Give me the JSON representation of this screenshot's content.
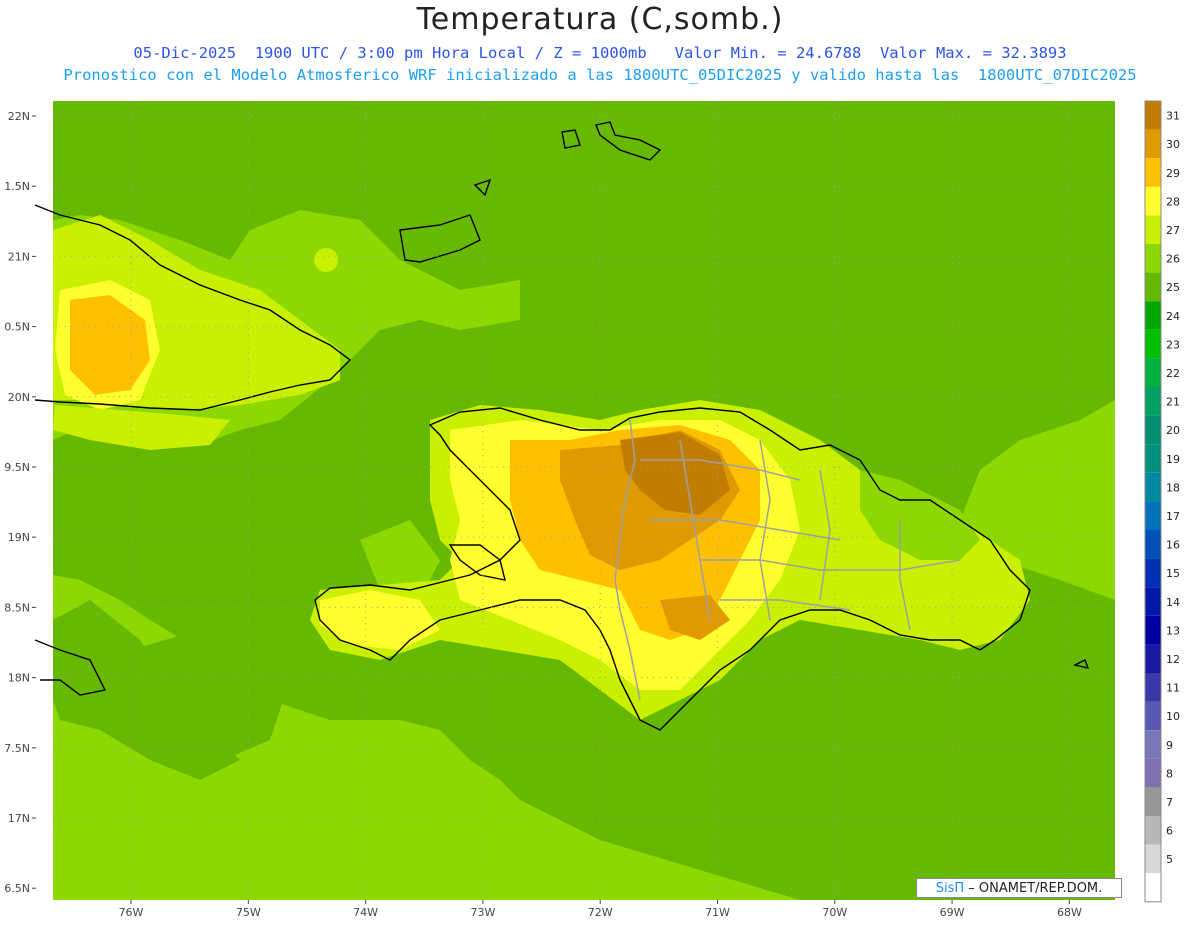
{
  "header": {
    "title": "Temperatura (C,somb.)",
    "line1": "05-Dic-2025  1900 UTC / 3:00 pm Hora Local / Z = 1000mb   Valor Min. = 24.6788  Valor Max. = 32.3893",
    "line2": "Pronostico con el Modelo Atmosferico WRF inicializado a las 1800UTC_05DIC2025 y valido hasta las  1800UTC_07DIC2025"
  },
  "axes": {
    "lat_labels": [
      "22N",
      "1.5N",
      "21N",
      "0.5N",
      "20N",
      "9.5N",
      "19N",
      "8.5N",
      "18N",
      "7.5N",
      "17N",
      "6.5N"
    ],
    "lon_labels": [
      "76W",
      "75W",
      "74W",
      "73W",
      "72W",
      "71W",
      "70W",
      "69W",
      "68W"
    ]
  },
  "colorbar": {
    "labels": [
      "31",
      "30",
      "29",
      "28",
      "27",
      "26",
      "25",
      "24",
      "23",
      "22",
      "21",
      "20",
      "19",
      "18",
      "17",
      "16",
      "15",
      "14",
      "13",
      "12",
      "11",
      "10",
      "9",
      "8",
      "7",
      "6",
      "5"
    ],
    "colors": [
      "#c07d00",
      "#e09a00",
      "#ffc000",
      "#ffff30",
      "#c8f000",
      "#8cd800",
      "#66b800",
      "#00a800",
      "#00c000",
      "#00b040",
      "#00a060",
      "#009070",
      "#009080",
      "#0088a0",
      "#0070b8",
      "#0050b8",
      "#0030b0",
      "#0018a8",
      "#0000a0",
      "#1818a0",
      "#3838a8",
      "#5858b0",
      "#7878b8",
      "#8070b0",
      "#989898",
      "#b8b8b8",
      "#d8d8d8",
      "#ffffff"
    ]
  },
  "map": {
    "ocean_color": "#8cd800",
    "cool_color": "#66b800",
    "warm_color": "#c8f000",
    "hot_color": "#ffff30"
  },
  "credit": {
    "brand": "SisΠ",
    "text": " – ONAMET/REP.DOM."
  }
}
